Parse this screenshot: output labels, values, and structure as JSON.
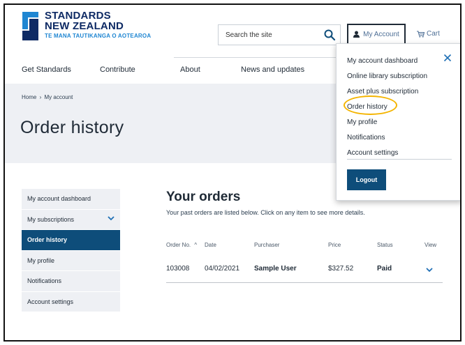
{
  "logo": {
    "line1": "STANDARDS",
    "line2": "NEW ZEALAND",
    "line3": "TE MANA TAUTIKANGA O AOTEAROA"
  },
  "search": {
    "placeholder": "Search the site"
  },
  "header": {
    "account_label": "My Account",
    "cart_label": "Cart"
  },
  "nav": {
    "items": [
      "Get Standards",
      "Contribute",
      "About",
      "News and updates"
    ]
  },
  "breadcrumb": {
    "home": "Home",
    "sep": "›",
    "current": "My account"
  },
  "page": {
    "title": "Order history"
  },
  "sidebar": {
    "items": [
      {
        "label": "My account dashboard"
      },
      {
        "label": "My subscriptions"
      },
      {
        "label": "Order history"
      },
      {
        "label": "My profile"
      },
      {
        "label": "Notifications"
      },
      {
        "label": "Account settings"
      }
    ]
  },
  "orders": {
    "title": "Your orders",
    "subtitle": "Your past orders are listed below. Click on any item to see more details.",
    "columns": {
      "order_no": "Order No.",
      "sort_icon": "^",
      "date": "Date",
      "purchaser": "Purchaser",
      "price": "Price",
      "status": "Status",
      "view": "View"
    },
    "rows": [
      {
        "order_no": "103008",
        "date": "04/02/2021",
        "purchaser": "Sample User",
        "price": "$327.52",
        "status": "Paid"
      }
    ]
  },
  "dropdown": {
    "items": [
      {
        "label": "My account dashboard"
      },
      {
        "label": "Online library subscription"
      },
      {
        "label": "Asset plus subscription"
      },
      {
        "label": "Order history"
      },
      {
        "label": "My profile"
      },
      {
        "label": "Notifications"
      },
      {
        "label": "Account settings"
      }
    ],
    "logout_label": "Logout"
  },
  "colors": {
    "brand_navy": "#0e2a64",
    "brand_blue": "#1f86d2",
    "active": "#0e4d7a",
    "highlight": "#f4b400"
  }
}
